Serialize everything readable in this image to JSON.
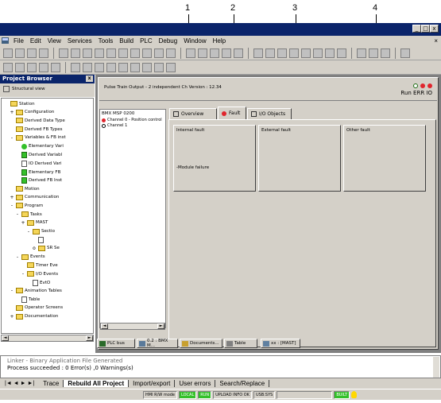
{
  "callouts": [
    "1",
    "2",
    "3",
    "4"
  ],
  "window": {
    "min": "_",
    "max": "□",
    "close": "x"
  },
  "menu": [
    "File",
    "Edit",
    "View",
    "Services",
    "Tools",
    "Build",
    "PLC",
    "Debug",
    "Window",
    "Help"
  ],
  "project_browser": {
    "title": "Project Browser",
    "close": "x",
    "view_label": "Structural view",
    "items": [
      {
        "label": "Station",
        "icon": "folder",
        "indent": 0,
        "exp": ""
      },
      {
        "label": "Configuration",
        "icon": "folder",
        "indent": 1,
        "exp": "+"
      },
      {
        "label": "Derived Data Type",
        "icon": "folder",
        "indent": 1,
        "exp": ""
      },
      {
        "label": "Derived FB Types",
        "icon": "folder",
        "indent": 1,
        "exp": ""
      },
      {
        "label": "Variables & FB inst",
        "icon": "folder",
        "indent": 1,
        "exp": "-"
      },
      {
        "label": "Elementary Vari",
        "icon": "green-ball",
        "indent": 2,
        "exp": ""
      },
      {
        "label": "Derived Variabl",
        "icon": "green-sq",
        "indent": 2,
        "exp": ""
      },
      {
        "label": "IO Derived Vari",
        "icon": "leaf",
        "indent": 2,
        "exp": ""
      },
      {
        "label": "Elementary FB",
        "icon": "green-sq",
        "indent": 2,
        "exp": ""
      },
      {
        "label": "Derived FB Inst",
        "icon": "green-sq",
        "indent": 2,
        "exp": ""
      },
      {
        "label": "Motion",
        "icon": "folder",
        "indent": 1,
        "exp": ""
      },
      {
        "label": "Communication",
        "icon": "folder",
        "indent": 1,
        "exp": "+"
      },
      {
        "label": "Program",
        "icon": "folder",
        "indent": 1,
        "exp": "-"
      },
      {
        "label": "Tasks",
        "icon": "folder",
        "indent": 2,
        "exp": "-"
      },
      {
        "label": "MAST",
        "icon": "folder",
        "indent": 3,
        "exp": "+"
      },
      {
        "label": "Sectio",
        "icon": "folder",
        "indent": 4,
        "exp": "-"
      },
      {
        "label": "",
        "icon": "leaf",
        "indent": 5,
        "exp": ""
      },
      {
        "label": "SR Se",
        "icon": "folder",
        "indent": 5,
        "exp": "o"
      },
      {
        "label": "Events",
        "icon": "folder",
        "indent": 2,
        "exp": "-"
      },
      {
        "label": "Timer Eve",
        "icon": "folder",
        "indent": 3,
        "exp": ""
      },
      {
        "label": "I/O Events",
        "icon": "folder",
        "indent": 3,
        "exp": "-"
      },
      {
        "label": "EvtO",
        "icon": "leaf",
        "indent": 4,
        "exp": ""
      },
      {
        "label": "Animation Tables",
        "icon": "folder",
        "indent": 1,
        "exp": "-"
      },
      {
        "label": "Table",
        "icon": "leaf",
        "indent": 2,
        "exp": ""
      },
      {
        "label": "Operator Screens",
        "icon": "folder",
        "indent": 1,
        "exp": ""
      },
      {
        "label": "Documentation",
        "icon": "folder",
        "indent": 1,
        "exp": "+"
      }
    ]
  },
  "module": {
    "header": "Pulse Train Output - 2 independent Ch Version : 12.34",
    "leds": "Run ERR IO",
    "name": "BMX MSP 0200",
    "channels": [
      "Channel 0 - Position control",
      "Channel 1"
    ]
  },
  "tabs": [
    "Overview",
    "Fault",
    "I/O Objects"
  ],
  "faults": [
    {
      "title": "Internal fault",
      "body": "-Module failure"
    },
    {
      "title": "External fault",
      "body": ""
    },
    {
      "title": "Other fault",
      "body": ""
    }
  ],
  "taskbar": [
    "PLC bus",
    "0.2 : BMX M...",
    "Documents...",
    "Table",
    "xx : [MAST]"
  ],
  "output": {
    "line1": "Linker - Binary Application File Generated",
    "line2": "Process succeeded : 0 Error(s) ,0 Warnings(s)"
  },
  "output_tabs": [
    "Trace",
    "Rebuild All Project",
    "Import/export",
    "User errors",
    "Search/Replace"
  ],
  "status": {
    "hmi": "HMI R/W mode",
    "local": "LOCAL",
    "run": "RUN",
    "upload": "UPLOAD INFO OK",
    "usb": "USB:SYS",
    "built": "BUILT"
  },
  "colors": {
    "title": "#0a246a",
    "face": "#d4d0c8",
    "led_green": "#34c02a",
    "led_red": "#e0252d"
  }
}
